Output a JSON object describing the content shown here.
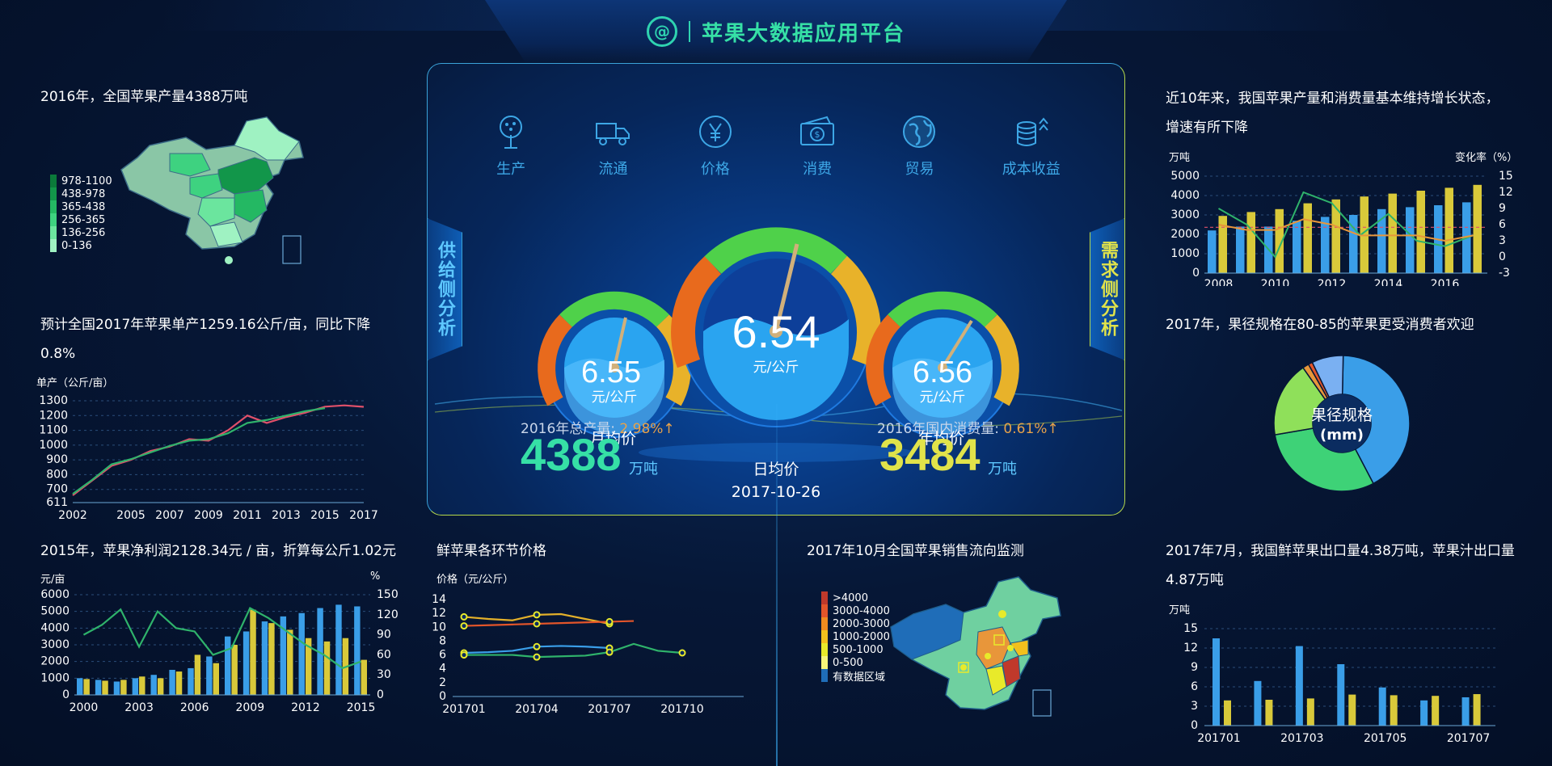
{
  "header": {
    "logo_glyph": "@",
    "title": "苹果大数据应用平台"
  },
  "nav": [
    {
      "label": "生产",
      "icon": "tree-icon"
    },
    {
      "label": "流通",
      "icon": "truck-icon"
    },
    {
      "label": "价格",
      "icon": "yen-icon"
    },
    {
      "label": "消费",
      "icon": "money-icon"
    },
    {
      "label": "贸易",
      "icon": "globe-icon"
    },
    {
      "label": "成本收益",
      "icon": "coins-icon"
    }
  ],
  "side_tabs": {
    "left": "供给侧分析",
    "right": "需求侧分析"
  },
  "gauges": {
    "left": {
      "value": "6.55",
      "unit": "元/公斤",
      "caption": "月均价"
    },
    "center": {
      "value": "6.54",
      "unit": "元/公斤",
      "caption": "日均价",
      "date": "2017-10-26"
    },
    "right": {
      "value": "6.56",
      "unit": "元/公斤",
      "caption": "年均价"
    }
  },
  "stats": {
    "production": {
      "label": "2016年总产量:",
      "pct": "2.98%↑",
      "value": "4388",
      "unit": "万吨"
    },
    "consumption": {
      "label": "2016年国内消费量:",
      "pct": "0.61%↑",
      "value": "3484",
      "unit": "万吨"
    }
  },
  "panels": {
    "map_production": {
      "title": "2016年，全国苹果产量4388万吨",
      "legend": [
        "978-1100",
        "438-978",
        "365-438",
        "256-365",
        "136-256",
        "0-136"
      ],
      "legend_colors": [
        "#0b7a3a",
        "#12964a",
        "#24b863",
        "#3ed280",
        "#6be59e",
        "#9ff2c2"
      ]
    },
    "yield": {
      "title_line1": "预计全国2017年苹果单产1259.16公斤/亩，同比下降",
      "title_line2": "0.8%",
      "unit": "单产（公斤/亩）"
    },
    "profit": {
      "title": "2015年，苹果净利润2128.34元 / 亩，折算每公斤1.02元",
      "unit_left": "元/亩",
      "unit_right": "%"
    },
    "fresh_price": {
      "title": "鲜苹果各环节价格",
      "unit": "价格（元/公斤）"
    },
    "flow_map": {
      "title": "2017年10月全国苹果销售流向监测",
      "legend": [
        ">4000",
        "3000-4000",
        "2000-3000",
        "1000-2000",
        "500-1000",
        "0-500",
        "有数据区域"
      ],
      "legend_colors": [
        "#c0392b",
        "#e3552a",
        "#f08a1f",
        "#f2c01d",
        "#e8ea2a",
        "#f7f57a",
        "#1f6db8"
      ]
    },
    "prod_consume": {
      "title_line1": "近10年来，我国苹果产量和消费量基本维持增长状态，",
      "title_line2": "增速有所下降",
      "unit_left": "万吨",
      "unit_right": "变化率（%）"
    },
    "fruit_size": {
      "title": "2017年，果径规格在80-85的苹果更受消费者欢迎",
      "center_label_1": "果径规格",
      "center_label_2": "(mm)"
    },
    "export": {
      "title_line1": "2017年7月，我国鲜苹果出口量4.38万吨，苹果汁出口量",
      "title_line2": "4.87万吨",
      "unit": "万吨"
    }
  },
  "chart_data": [
    {
      "id": "yield",
      "type": "line",
      "x": [
        2002,
        2003,
        2004,
        2005,
        2006,
        2007,
        2008,
        2009,
        2010,
        2011,
        2012,
        2013,
        2014,
        2015,
        2016,
        2017
      ],
      "xticks": [
        "2002",
        "2005",
        "2007",
        "2009",
        "2011",
        "2013",
        "2015",
        "2017"
      ],
      "yticks": [
        "611",
        "700",
        "800",
        "900",
        "1000",
        "1100",
        "1200",
        "1300"
      ],
      "ylim": [
        611,
        1300
      ],
      "series": [
        {
          "color": "#e0506a",
          "values": [
            660,
            760,
            860,
            900,
            960,
            990,
            1040,
            1030,
            1100,
            1200,
            1150,
            1190,
            1220,
            1260,
            1269,
            1259
          ]
        },
        {
          "color": "#2fb36b",
          "values": [
            670,
            765,
            870,
            905,
            950,
            995,
            1030,
            1040,
            1080,
            1150,
            1170,
            1200,
            1230,
            1250
          ]
        }
      ]
    },
    {
      "id": "profit",
      "type": "bar",
      "categories": [
        "2000",
        "2001",
        "2002",
        "2003",
        "2004",
        "2005",
        "2006",
        "2007",
        "2008",
        "2009",
        "2010",
        "2011",
        "2012",
        "2013",
        "2014",
        "2015"
      ],
      "xticks": [
        "2000",
        "2003",
        "2006",
        "2009",
        "2012",
        "2015"
      ],
      "yticks_left": [
        "0",
        "1000",
        "2000",
        "3000",
        "4000",
        "5000",
        "6000"
      ],
      "yticks_right": [
        "0",
        "30",
        "60",
        "90",
        "120",
        "150"
      ],
      "ylim_left": [
        0,
        6000
      ],
      "ylim_right": [
        0,
        150
      ],
      "series": [
        {
          "color": "#3a9ee8",
          "values": [
            1000,
            900,
            800,
            1000,
            1200,
            1500,
            1600,
            2300,
            3500,
            3800,
            4400,
            4700,
            4900,
            5200,
            5400,
            5300
          ]
        },
        {
          "color": "#d9c93a",
          "values": [
            950,
            850,
            900,
            1100,
            1000,
            1400,
            2400,
            1900,
            3000,
            5100,
            4300,
            3900,
            3400,
            3200,
            3400,
            2100
          ]
        }
      ],
      "line": {
        "color": "#2fb36b",
        "values": [
          90,
          105,
          128,
          72,
          125,
          100,
          95,
          60,
          70,
          130,
          115,
          95,
          75,
          60,
          40,
          50
        ]
      }
    },
    {
      "id": "fresh_price",
      "type": "line",
      "x": [
        "201701",
        "201702",
        "201703",
        "201704",
        "201705",
        "201706",
        "201707",
        "201708",
        "201709",
        "201710"
      ],
      "xticks": [
        "201701",
        "201704",
        "201707",
        "201710"
      ],
      "yticks": [
        "0",
        "2",
        "4",
        "6",
        "8",
        "10",
        "12",
        "14"
      ],
      "ylim": [
        0,
        14
      ],
      "series": [
        {
          "color": "#e3b02a",
          "values": [
            11.5,
            11.2,
            11.0,
            11.8,
            11.9,
            11.2,
            10.5
          ]
        },
        {
          "color": "#e3552a",
          "values": [
            10.2,
            10.3,
            10.4,
            10.5,
            10.6,
            10.7,
            10.8,
            10.9
          ]
        },
        {
          "color": "#3a9ee8",
          "values": [
            6.3,
            6.4,
            6.6,
            7.2,
            7.3,
            7.2,
            7.0
          ]
        },
        {
          "color": "#2fb36b",
          "values": [
            6.0,
            6.0,
            6.0,
            5.7,
            5.8,
            5.9,
            6.4,
            7.6,
            6.6,
            6.3
          ]
        }
      ]
    },
    {
      "id": "prod_consume",
      "type": "bar",
      "categories": [
        "2008",
        "2009",
        "2010",
        "2011",
        "2012",
        "2013",
        "2014",
        "2015",
        "2016",
        "2017"
      ],
      "xticks": [
        "2008",
        "2010",
        "2012",
        "2014",
        "2016"
      ],
      "yticks_left": [
        "0",
        "1000",
        "2000",
        "3000",
        "4000",
        "5000"
      ],
      "yticks_right": [
        "-3",
        "0",
        "3",
        "6",
        "9",
        "12",
        "15"
      ],
      "ylim_left": [
        0,
        5000
      ],
      "ylim_right": [
        -3,
        15
      ],
      "series": [
        {
          "color": "#3a9ee8",
          "values": [
            2200,
            2400,
            2400,
            2700,
            2900,
            3000,
            3300,
            3400,
            3500,
            3650
          ]
        },
        {
          "color": "#d9c93a",
          "values": [
            2950,
            3150,
            3300,
            3600,
            3800,
            3950,
            4100,
            4250,
            4400,
            4550
          ]
        }
      ],
      "lines": [
        {
          "color": "#2fb36b",
          "values": [
            9,
            6,
            0,
            12,
            10,
            4,
            8,
            3,
            2,
            4
          ]
        },
        {
          "color": "#e8963a",
          "values": [
            6,
            5,
            5,
            7,
            6,
            4,
            4,
            4,
            3,
            4
          ]
        }
      ],
      "ref_line": 5.5
    },
    {
      "id": "fruit_size",
      "type": "pie",
      "slices": [
        {
          "value": 42,
          "color": "#3a9ee8"
        },
        {
          "value": 30,
          "color": "#3ed277"
        },
        {
          "value": 18,
          "color": "#8fe05a"
        },
        {
          "value": 1.5,
          "color": "#e8963a"
        },
        {
          "value": 1,
          "color": "#e3552a"
        },
        {
          "value": 7.5,
          "color": "#7ab0f2"
        }
      ]
    },
    {
      "id": "export",
      "type": "bar",
      "categories": [
        "201701",
        "201702",
        "201703",
        "201704",
        "201705",
        "201706",
        "201707"
      ],
      "xticks": [
        "201701",
        "201703",
        "201705",
        "201707"
      ],
      "yticks": [
        "0",
        "3",
        "6",
        "9",
        "12",
        "15"
      ],
      "ylim": [
        0,
        15
      ],
      "series": [
        {
          "color": "#3a9ee8",
          "values": [
            13.5,
            6.9,
            12.3,
            9.5,
            5.9,
            3.9,
            4.38
          ]
        },
        {
          "color": "#d9c93a",
          "values": [
            3.9,
            4.0,
            4.2,
            4.8,
            4.7,
            4.6,
            4.87
          ]
        }
      ]
    }
  ]
}
